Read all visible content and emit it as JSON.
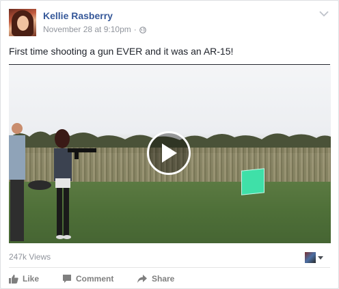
{
  "post": {
    "author": "Kellie Rasberry",
    "timestamp": "November 28 at 9:10pm",
    "separator": "·",
    "privacy_icon": "globe-icon",
    "text": "First time shooting a gun EVER and it was an AR-15!",
    "video": {
      "play_icon": "play-icon"
    },
    "views": "247k Views"
  },
  "actions": {
    "like_label": "Like",
    "comment_label": "Comment",
    "share_label": "Share"
  },
  "colors": {
    "author_link": "#365899",
    "meta_gray": "#90949c",
    "action_gray": "#7f7f7f",
    "target_green": "#3fe0a8"
  }
}
